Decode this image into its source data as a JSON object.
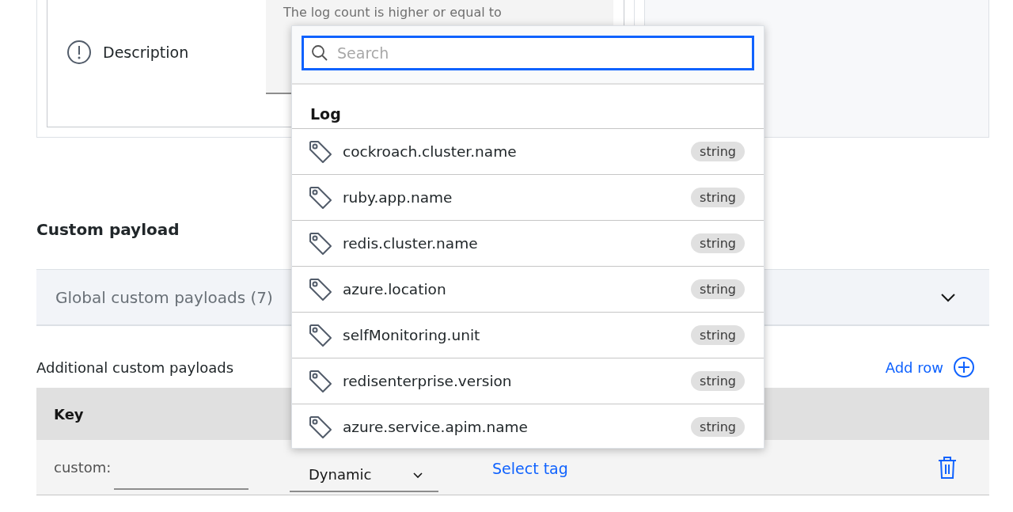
{
  "condition_card": {
    "label": "Description",
    "description_value": "The log count is higher or equal to"
  },
  "section_title": "Custom payload",
  "global_payloads": {
    "label": "Global custom payloads (7)",
    "expanded": false
  },
  "additional": {
    "title": "Additional custom payloads",
    "add_button": "Add row"
  },
  "table": {
    "columns": [
      "Key"
    ],
    "rows": [
      {
        "key_prefix": "custom:",
        "type": "Dynamic",
        "value_link": "Select tag"
      }
    ]
  },
  "tag_dropdown": {
    "search_placeholder": "Search",
    "group": "Log",
    "items": [
      {
        "name": "cockroach.cluster.name",
        "type": "string"
      },
      {
        "name": "ruby.app.name",
        "type": "string"
      },
      {
        "name": "redis.cluster.name",
        "type": "string"
      },
      {
        "name": "azure.location",
        "type": "string"
      },
      {
        "name": "selfMonitoring.unit",
        "type": "string"
      },
      {
        "name": "redisenterprise.version",
        "type": "string"
      },
      {
        "name": "azure.service.apim.name",
        "type": "string"
      }
    ]
  }
}
